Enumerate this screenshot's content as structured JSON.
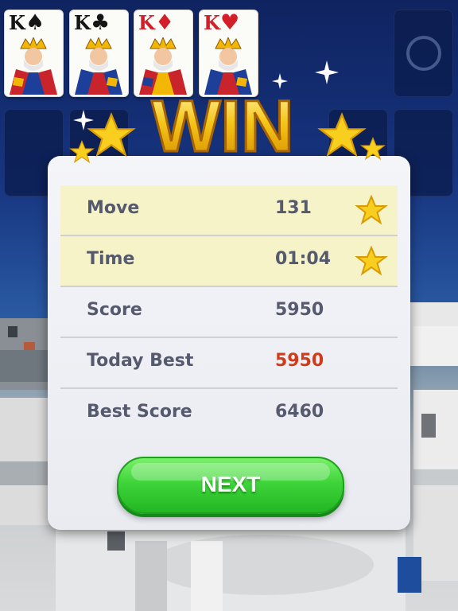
{
  "foundation_cards": [
    {
      "rank": "K",
      "suit": "♠",
      "color": "black"
    },
    {
      "rank": "K",
      "suit": "♣",
      "color": "black"
    },
    {
      "rank": "K",
      "suit": "♦",
      "color": "red"
    },
    {
      "rank": "K",
      "suit": "♥",
      "color": "red"
    }
  ],
  "win_dialog": {
    "title": "WIN",
    "rows": [
      {
        "label": "Move",
        "value": "131",
        "star": true
      },
      {
        "label": "Time",
        "value": "01:04",
        "star": true
      },
      {
        "label": "Score",
        "value": "5950",
        "star": false
      },
      {
        "label": "Today Best",
        "value": "5950",
        "star": false
      },
      {
        "label": "Best Score",
        "value": "6460",
        "star": false
      }
    ],
    "next_label": "NEXT"
  },
  "colors": {
    "highlight_row": "#f7f3c8",
    "today_best_value": "#d23a1a",
    "next_button": "#3fd43a",
    "title_gold": "#f5c518"
  },
  "icons": {
    "stock": "circle-refresh-icon",
    "row_rating": "star-icon"
  }
}
